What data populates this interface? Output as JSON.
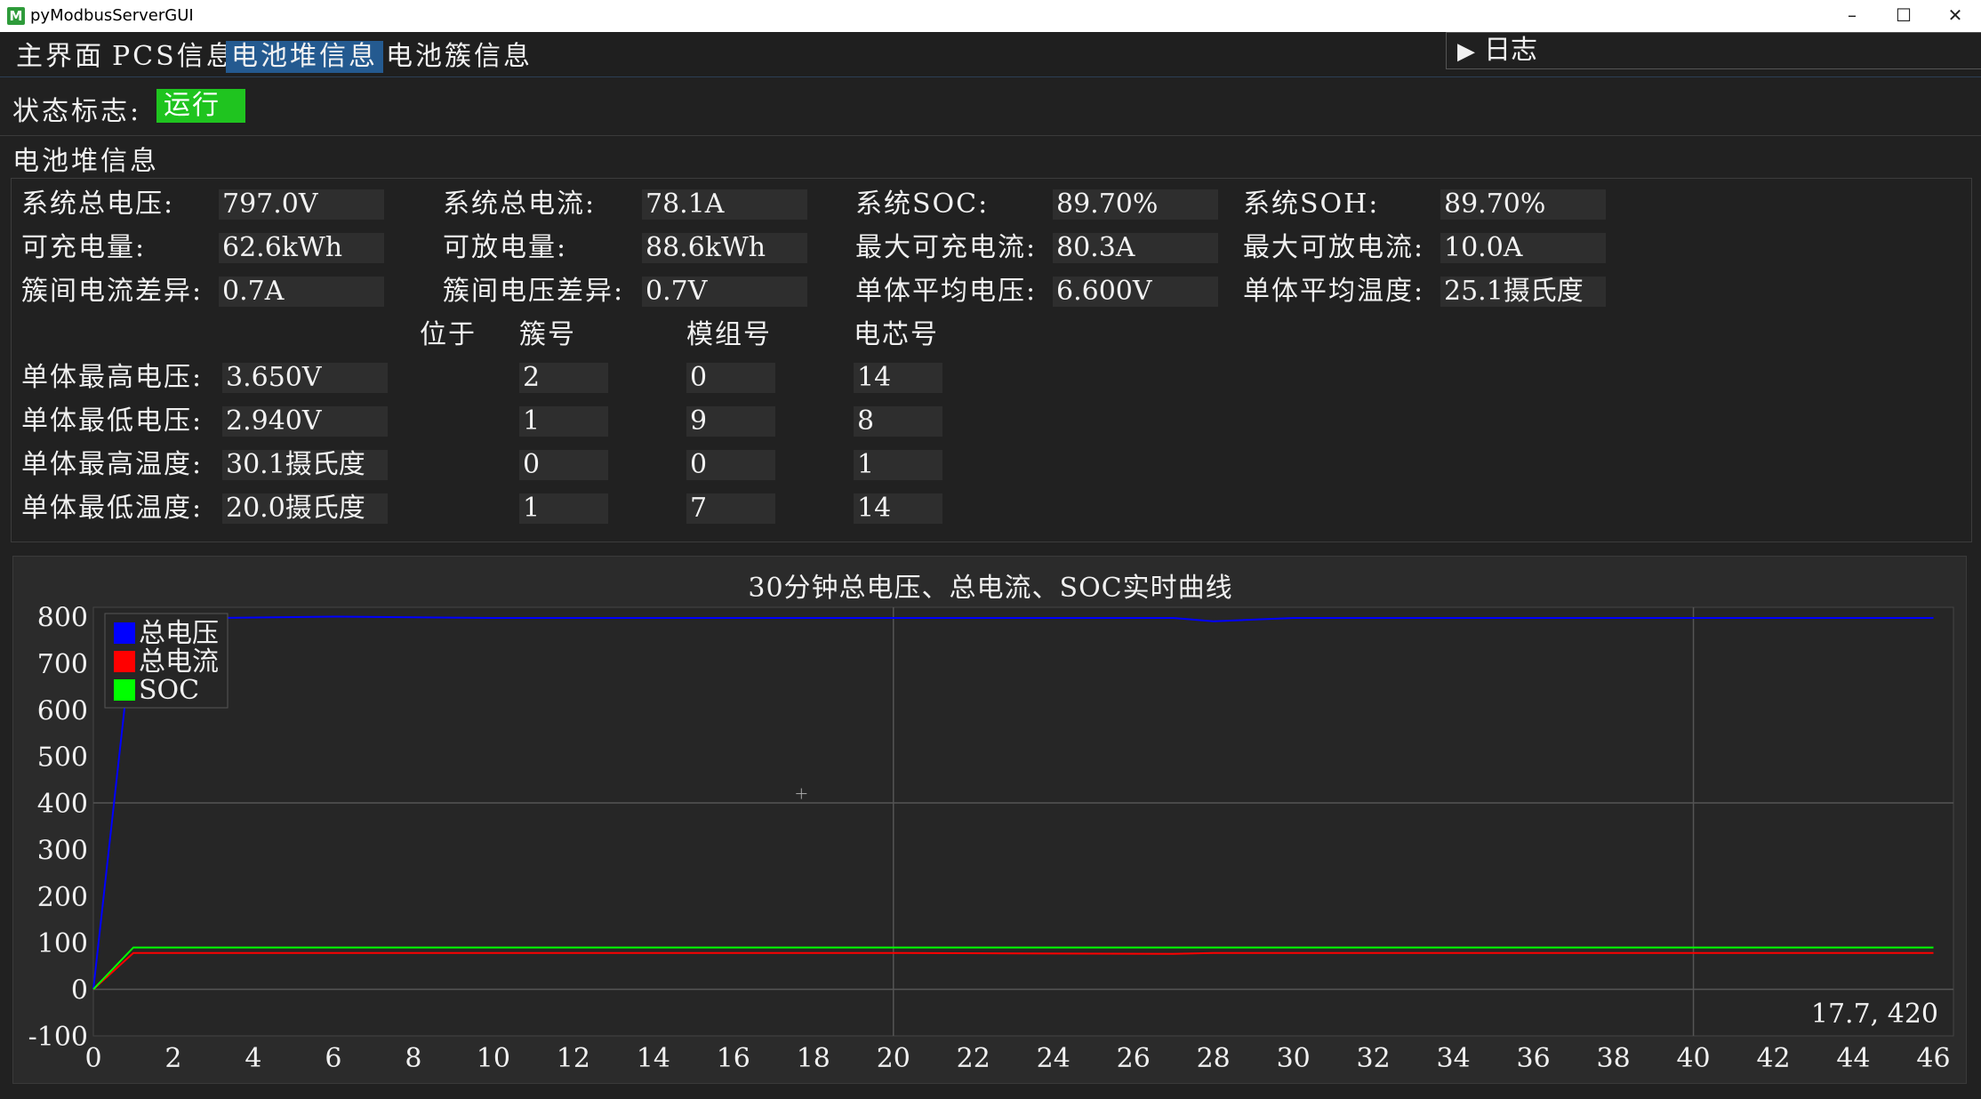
{
  "window": {
    "title": "pyModbusServerGUI",
    "icon": "M"
  },
  "tabs": [
    {
      "label": "主界面",
      "active": false
    },
    {
      "label": "PCS信息",
      "active": false
    },
    {
      "label": "电池堆信息",
      "active": true
    },
    {
      "label": "电池簇信息",
      "active": false
    }
  ],
  "log_toggle": {
    "icon": "play-triangle-icon",
    "label": "日志"
  },
  "status": {
    "label": "状态标志:",
    "value": "运行",
    "color": "#1fc41f"
  },
  "group_title": "电池堆信息",
  "summary": [
    {
      "label": "系统总电压:",
      "value": "797.0V"
    },
    {
      "label": "系统总电流:",
      "value": "78.1A"
    },
    {
      "label": "系统SOC:",
      "value": "89.70%"
    },
    {
      "label": "系统SOH:",
      "value": "89.70%"
    },
    {
      "label": "可充电量:",
      "value": "62.6kWh"
    },
    {
      "label": "可放电量:",
      "value": "88.6kWh"
    },
    {
      "label": "最大可充电流:",
      "value": "80.3A"
    },
    {
      "label": "最大可放电流:",
      "value": "10.0A"
    },
    {
      "label": "簇间电流差异:",
      "value": "0.7A"
    },
    {
      "label": "簇间电压差异:",
      "value": "0.7V"
    },
    {
      "label": "单体平均电压:",
      "value": "6.600V"
    },
    {
      "label": "单体平均温度:",
      "value": "25.1摄氏度"
    }
  ],
  "location_headers": {
    "located": "位于",
    "cluster": "簇号",
    "module": "模组号",
    "cell": "电芯号"
  },
  "extremes": [
    {
      "label": "单体最高电压:",
      "value": "3.650V",
      "cluster": "2",
      "module": "0",
      "cell": "14"
    },
    {
      "label": "单体最低电压:",
      "value": "2.940V",
      "cluster": "1",
      "module": "9",
      "cell": "8"
    },
    {
      "label": "单体最高温度:",
      "value": "30.1摄氏度",
      "cluster": "0",
      "module": "0",
      "cell": "1"
    },
    {
      "label": "单体最低温度:",
      "value": "20.0摄氏度",
      "cluster": "1",
      "module": "7",
      "cell": "14"
    }
  ],
  "chart_data": {
    "type": "line",
    "title": "30分钟总电压、总电流、SOC实时曲线",
    "xlim": [
      0,
      46.5
    ],
    "ylim": [
      -100,
      820
    ],
    "x_ticks": [
      0,
      2,
      4,
      6,
      8,
      10,
      12,
      14,
      16,
      18,
      20,
      22,
      24,
      26,
      28,
      30,
      32,
      34,
      36,
      38,
      40,
      42,
      44,
      46
    ],
    "y_ticks": [
      -100,
      0,
      100,
      200,
      300,
      400,
      500,
      600,
      700,
      800
    ],
    "grid": true,
    "legend_position": "top-left",
    "cursor_readout": "17.7, 420",
    "series": [
      {
        "name": "总电压",
        "color": "#0000ff",
        "x": [
          0,
          0.8,
          1,
          3,
          6,
          10,
          20,
          27,
          28,
          30,
          40,
          46
        ],
        "y": [
          0,
          620,
          797,
          797,
          800,
          797,
          797,
          797,
          790,
          797,
          797,
          797
        ]
      },
      {
        "name": "总电流",
        "color": "#ff0000",
        "x": [
          0,
          1,
          5,
          10,
          20,
          27,
          28,
          30,
          40,
          46
        ],
        "y": [
          0,
          78,
          78,
          78,
          78,
          76,
          78,
          78,
          78,
          78
        ]
      },
      {
        "name": "SOC",
        "color": "#00ff00",
        "x": [
          0,
          1,
          5,
          10,
          20,
          30,
          40,
          46
        ],
        "y": [
          0,
          89.7,
          89.7,
          89.7,
          89.7,
          89.7,
          89.7,
          89.7
        ]
      }
    ]
  }
}
